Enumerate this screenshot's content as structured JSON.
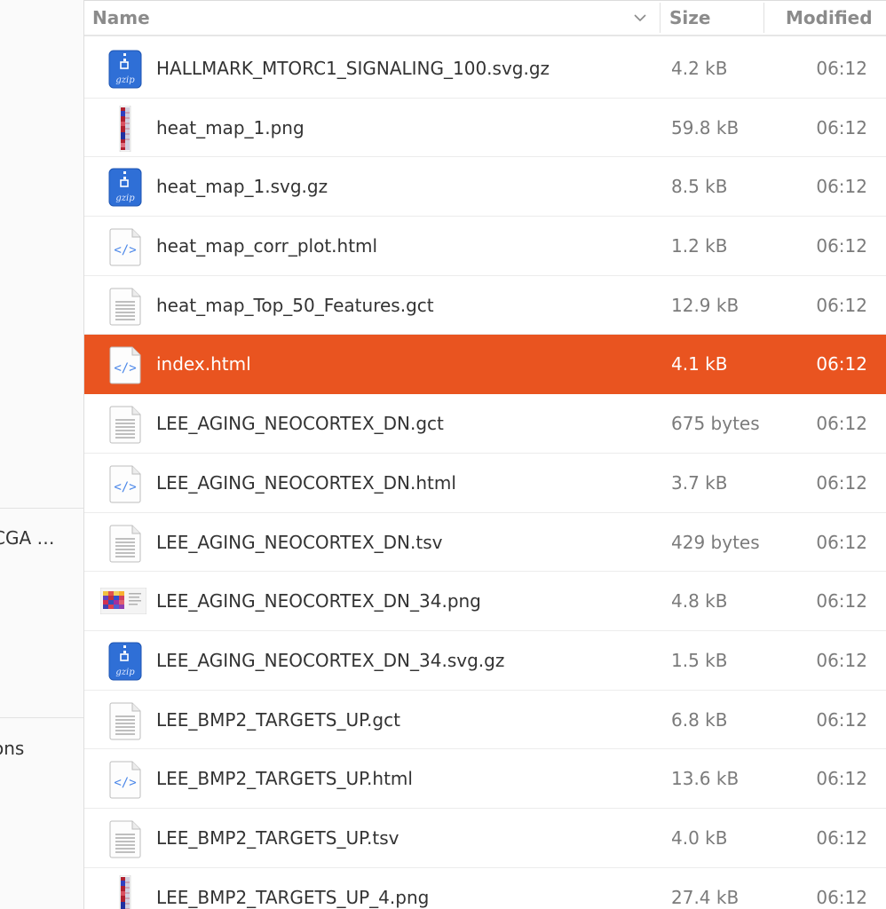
{
  "sidebar": {
    "items": [
      {
        "label": "CGA …"
      },
      {
        "label": "ons"
      }
    ]
  },
  "header": {
    "name": "Name",
    "size": "Size",
    "modified": "Modified"
  },
  "files": [
    {
      "name": "HALLMARK_MTORC1_SIGNALING_100.svg.gz",
      "size": "4.2 kB",
      "modified": "06:12",
      "icon": "gzip-icon"
    },
    {
      "name": "heat_map_1.png",
      "size": "59.8 kB",
      "modified": "06:12",
      "icon": "heatmap-thumbnail-icon"
    },
    {
      "name": "heat_map_1.svg.gz",
      "size": "8.5 kB",
      "modified": "06:12",
      "icon": "gzip-icon"
    },
    {
      "name": "heat_map_corr_plot.html",
      "size": "1.2 kB",
      "modified": "06:12",
      "icon": "html-icon"
    },
    {
      "name": "heat_map_Top_50_Features.gct",
      "size": "12.9 kB",
      "modified": "06:12",
      "icon": "text-file-icon"
    },
    {
      "name": "index.html",
      "size": "4.1 kB",
      "modified": "06:12",
      "icon": "html-icon",
      "selected": true
    },
    {
      "name": "LEE_AGING_NEOCORTEX_DN.gct",
      "size": "675 bytes",
      "modified": "06:12",
      "icon": "text-file-icon"
    },
    {
      "name": "LEE_AGING_NEOCORTEX_DN.html",
      "size": "3.7 kB",
      "modified": "06:12",
      "icon": "html-icon"
    },
    {
      "name": "LEE_AGING_NEOCORTEX_DN.tsv",
      "size": "429 bytes",
      "modified": "06:12",
      "icon": "text-file-icon"
    },
    {
      "name": "LEE_AGING_NEOCORTEX_DN_34.png",
      "size": "4.8 kB",
      "modified": "06:12",
      "icon": "image-thumbnail-icon"
    },
    {
      "name": "LEE_AGING_NEOCORTEX_DN_34.svg.gz",
      "size": "1.5 kB",
      "modified": "06:12",
      "icon": "gzip-icon"
    },
    {
      "name": "LEE_BMP2_TARGETS_UP.gct",
      "size": "6.8 kB",
      "modified": "06:12",
      "icon": "text-file-icon"
    },
    {
      "name": "LEE_BMP2_TARGETS_UP.html",
      "size": "13.6 kB",
      "modified": "06:12",
      "icon": "html-icon"
    },
    {
      "name": "LEE_BMP2_TARGETS_UP.tsv",
      "size": "4.0 kB",
      "modified": "06:12",
      "icon": "text-file-icon"
    },
    {
      "name": "LEE_BMP2_TARGETS_UP_4.png",
      "size": "27.4 kB",
      "modified": "06:12",
      "icon": "heatmap-thumbnail-icon"
    }
  ],
  "colors": {
    "selection": "#e95420",
    "gzip": "#2f6fd6",
    "html_tag": "#4a86e8"
  }
}
